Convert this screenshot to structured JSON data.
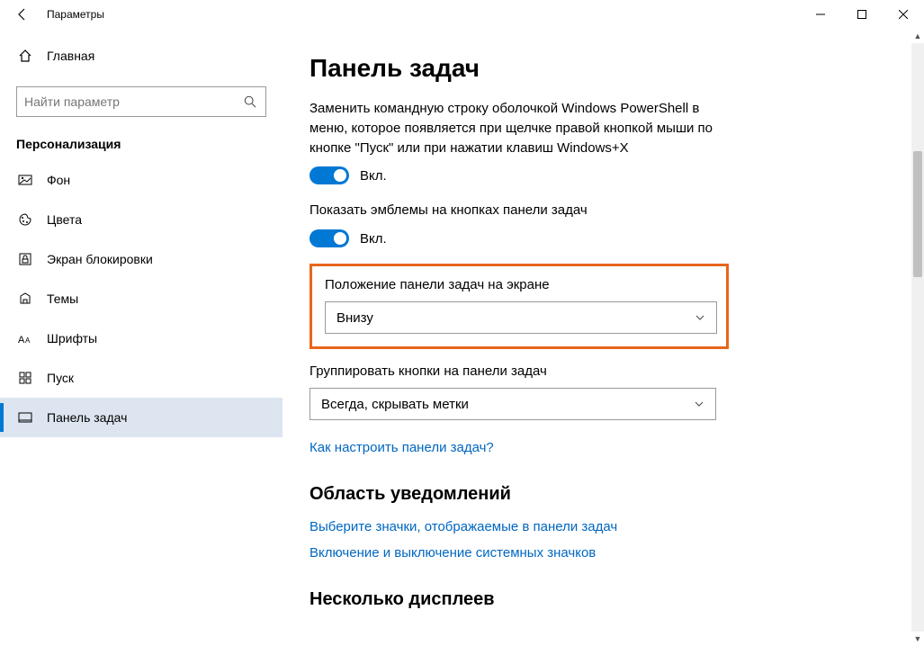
{
  "window": {
    "title": "Параметры"
  },
  "sidebar": {
    "home": "Главная",
    "search_placeholder": "Найти параметр",
    "section": "Персонализация",
    "items": [
      {
        "label": "Фон"
      },
      {
        "label": "Цвета"
      },
      {
        "label": "Экран блокировки"
      },
      {
        "label": "Темы"
      },
      {
        "label": "Шрифты"
      },
      {
        "label": "Пуск"
      },
      {
        "label": "Панель задач"
      }
    ]
  },
  "main": {
    "title": "Панель задач",
    "setting1": {
      "desc": "Заменить командную строку оболочкой Windows PowerShell в меню, которое появляется при щелчке правой кнопкой мыши по кнопке \"Пуск\" или при нажатии клавиш Windows+X",
      "state": "Вкл."
    },
    "setting2": {
      "desc": "Показать эмблемы на кнопках панели задач",
      "state": "Вкл."
    },
    "position": {
      "label": "Положение панели задач на экране",
      "value": "Внизу"
    },
    "grouping": {
      "label": "Группировать кнопки на панели задач",
      "value": "Всегда, скрывать метки"
    },
    "help_link": "Как настроить панели задач?",
    "notif_heading": "Область уведомлений",
    "notif_link1": "Выберите значки, отображаемые в панели задач",
    "notif_link2": "Включение и выключение системных значков",
    "displays_heading": "Несколько дисплеев"
  }
}
